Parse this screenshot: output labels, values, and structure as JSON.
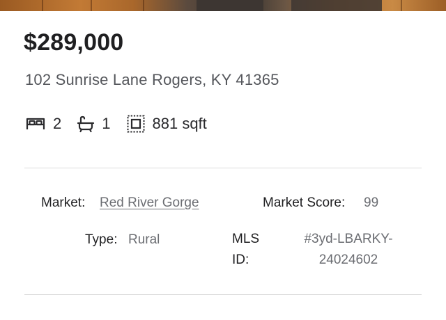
{
  "listing": {
    "price": "$289,000",
    "address": "102 Sunrise Lane Rogers, KY 41365"
  },
  "features": {
    "beds": "2",
    "baths": "1",
    "area": "881 sqft",
    "icons": [
      "bed-icon",
      "bathtub-icon",
      "floor-area-icon"
    ]
  },
  "details": {
    "market_label": "Market:",
    "market_value": "Red River Gorge",
    "score_label": "Market Score:",
    "score_value": "99",
    "type_label": "Type:",
    "type_value": "Rural",
    "mls_label_line1": "MLS",
    "mls_label_line2": "ID:",
    "mls_value_line1": "#3yd-LBARKY-",
    "mls_value_line2": "24024602"
  },
  "colors": {
    "price": "#1f1f21",
    "secondary_text": "#55575c",
    "value_text": "#6b6d72",
    "divider": "#dadada"
  }
}
